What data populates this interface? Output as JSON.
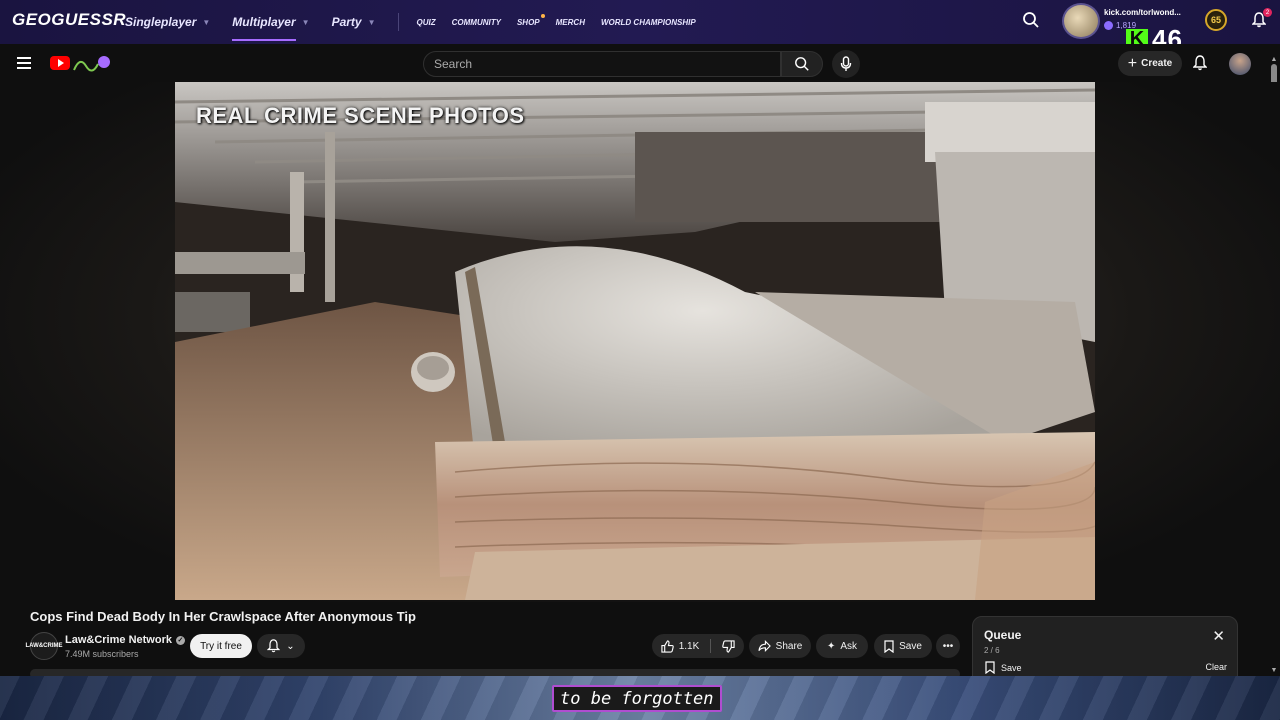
{
  "geoguessr": {
    "logo": "GEOGUESSR",
    "nav": [
      {
        "label": "Singleplayer",
        "active": false
      },
      {
        "label": "Multiplayer",
        "active": true
      },
      {
        "label": "Party",
        "active": false
      }
    ],
    "links": [
      "QUIZ",
      "COMMUNITY",
      "SHOP",
      "MERCH",
      "WORLD CHAMPIONSHIP"
    ],
    "username": "kick.com/torlwond...",
    "coins": "1,819",
    "level": "65",
    "notifications": "2"
  },
  "kick_overlay": {
    "logo_letter": "K",
    "count": "46",
    "color": "#53fc18"
  },
  "youtube": {
    "search_placeholder": "Search",
    "create_label": "Create",
    "video": {
      "overlay_text": "REAL CRIME SCENE PHOTOS",
      "title": "Cops Find Dead Body In Her Crawlspace After Anonymous Tip"
    },
    "channel": {
      "avatar_text": "LAW&CRIME",
      "name": "Law&Crime Network",
      "subscribers": "7.49M subscribers",
      "try_label": "Try it free"
    },
    "actions": {
      "likes": "1.1K",
      "share": "Share",
      "ask": "Ask",
      "save": "Save"
    },
    "queue": {
      "title": "Queue",
      "count": "2 / 6",
      "save_label": "Save",
      "clear_label": "Clear"
    }
  },
  "caption": "to be forgotten",
  "colors": {
    "accent_purple": "#a66bff",
    "yt_red": "#ff0000",
    "caption_border": "#b04dd1"
  }
}
